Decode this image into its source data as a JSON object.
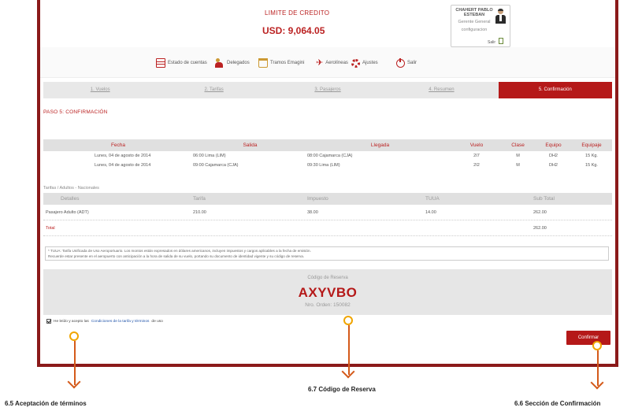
{
  "header": {
    "credit_title": "LIMITE DE CREDITO",
    "credit_amount": "USD: 9,064.05",
    "user": {
      "name": "CHAHERT PABLO ESTEBAN",
      "role": "Gerente General",
      "link": "configuracion",
      "logout": "Salir"
    }
  },
  "nav": {
    "items": [
      {
        "label": "Estado de cuentas",
        "icon": "statement-icon"
      },
      {
        "label": "Delegados",
        "icon": "delegates-icon"
      },
      {
        "label": "Tramos Emagini",
        "icon": "trash-icon"
      },
      {
        "label": "Aerolíneas",
        "icon": "airplane-icon"
      },
      {
        "label": "Ajustes",
        "icon": "settings-gear-icon"
      },
      {
        "label": "Salir",
        "icon": "power-icon"
      }
    ]
  },
  "steps": [
    {
      "label": "1. Vuelos",
      "active": false
    },
    {
      "label": "2. Tarifas",
      "active": false
    },
    {
      "label": "3. Pasajeros",
      "active": false
    },
    {
      "label": "4. Resumen",
      "active": false
    },
    {
      "label": "5. Confirmación",
      "active": true
    }
  ],
  "confirmation": {
    "title": "PASO 5: CONFIRMACIÓN",
    "flights_table": {
      "headers": [
        "Fecha",
        "Salida",
        "Llegada",
        "Vuelo",
        "Clase",
        "Equipo",
        "Equipaje"
      ],
      "rows": [
        [
          "Lunes, 04 de agosto de 2014",
          "06:00 Lima (LIM)",
          "08:00 Cajamarca (CJA)",
          "2I7",
          "M",
          "DH2",
          "15 Kg."
        ],
        [
          "Lunes, 04 de agosto de 2014",
          "09:00 Cajamarca (CJA)",
          "09:30 Lima (LIM)",
          "2I2",
          "M",
          "DH2",
          "15 Kg."
        ]
      ]
    },
    "fares_label": "Tarifas / Adultos - Nacionales",
    "fares_table": {
      "headers": [
        "Detalles",
        "Tarifa",
        "Impuesto",
        "TUUA",
        "Sub Total"
      ],
      "rows": [
        [
          "Pasajero Adulto (ADT)",
          "210.00",
          "38.00",
          "14.00",
          "262.00"
        ],
        [
          "Total",
          "",
          "",
          "",
          "262.00"
        ]
      ]
    },
    "notes": [
      "* TUUA: Tarifa Unificada de Uso Aeroportuario. Los montos están expresados en dólares americanos, incluyen impuestos y cargos aplicables a la fecha de emisión.",
      "Recuerde estar presente en el aeropuerto con anticipación a la hora de salida de su vuelo, portando su documento de identidad vigente y su código de reserva."
    ],
    "reservation": {
      "caption": "Código de Reserva",
      "code": "AXYVBO",
      "number_label": "Nro. Orden: 150082"
    },
    "terms": {
      "prefix": "He leído y acepto las",
      "link": "Condiciones de la tarifa y términos",
      "suffix": "de uso"
    },
    "confirm_button": "Confirmar"
  },
  "annotations": {
    "terms": "6.5 Aceptación de términos",
    "code": "6.7 Código de Reserva",
    "confirm": "6.6 Sección de Confirmación"
  },
  "colors": {
    "brand_red": "#b51919",
    "annotation_marker": "#f0a500",
    "annotation_arrow": "#d45a1a"
  }
}
